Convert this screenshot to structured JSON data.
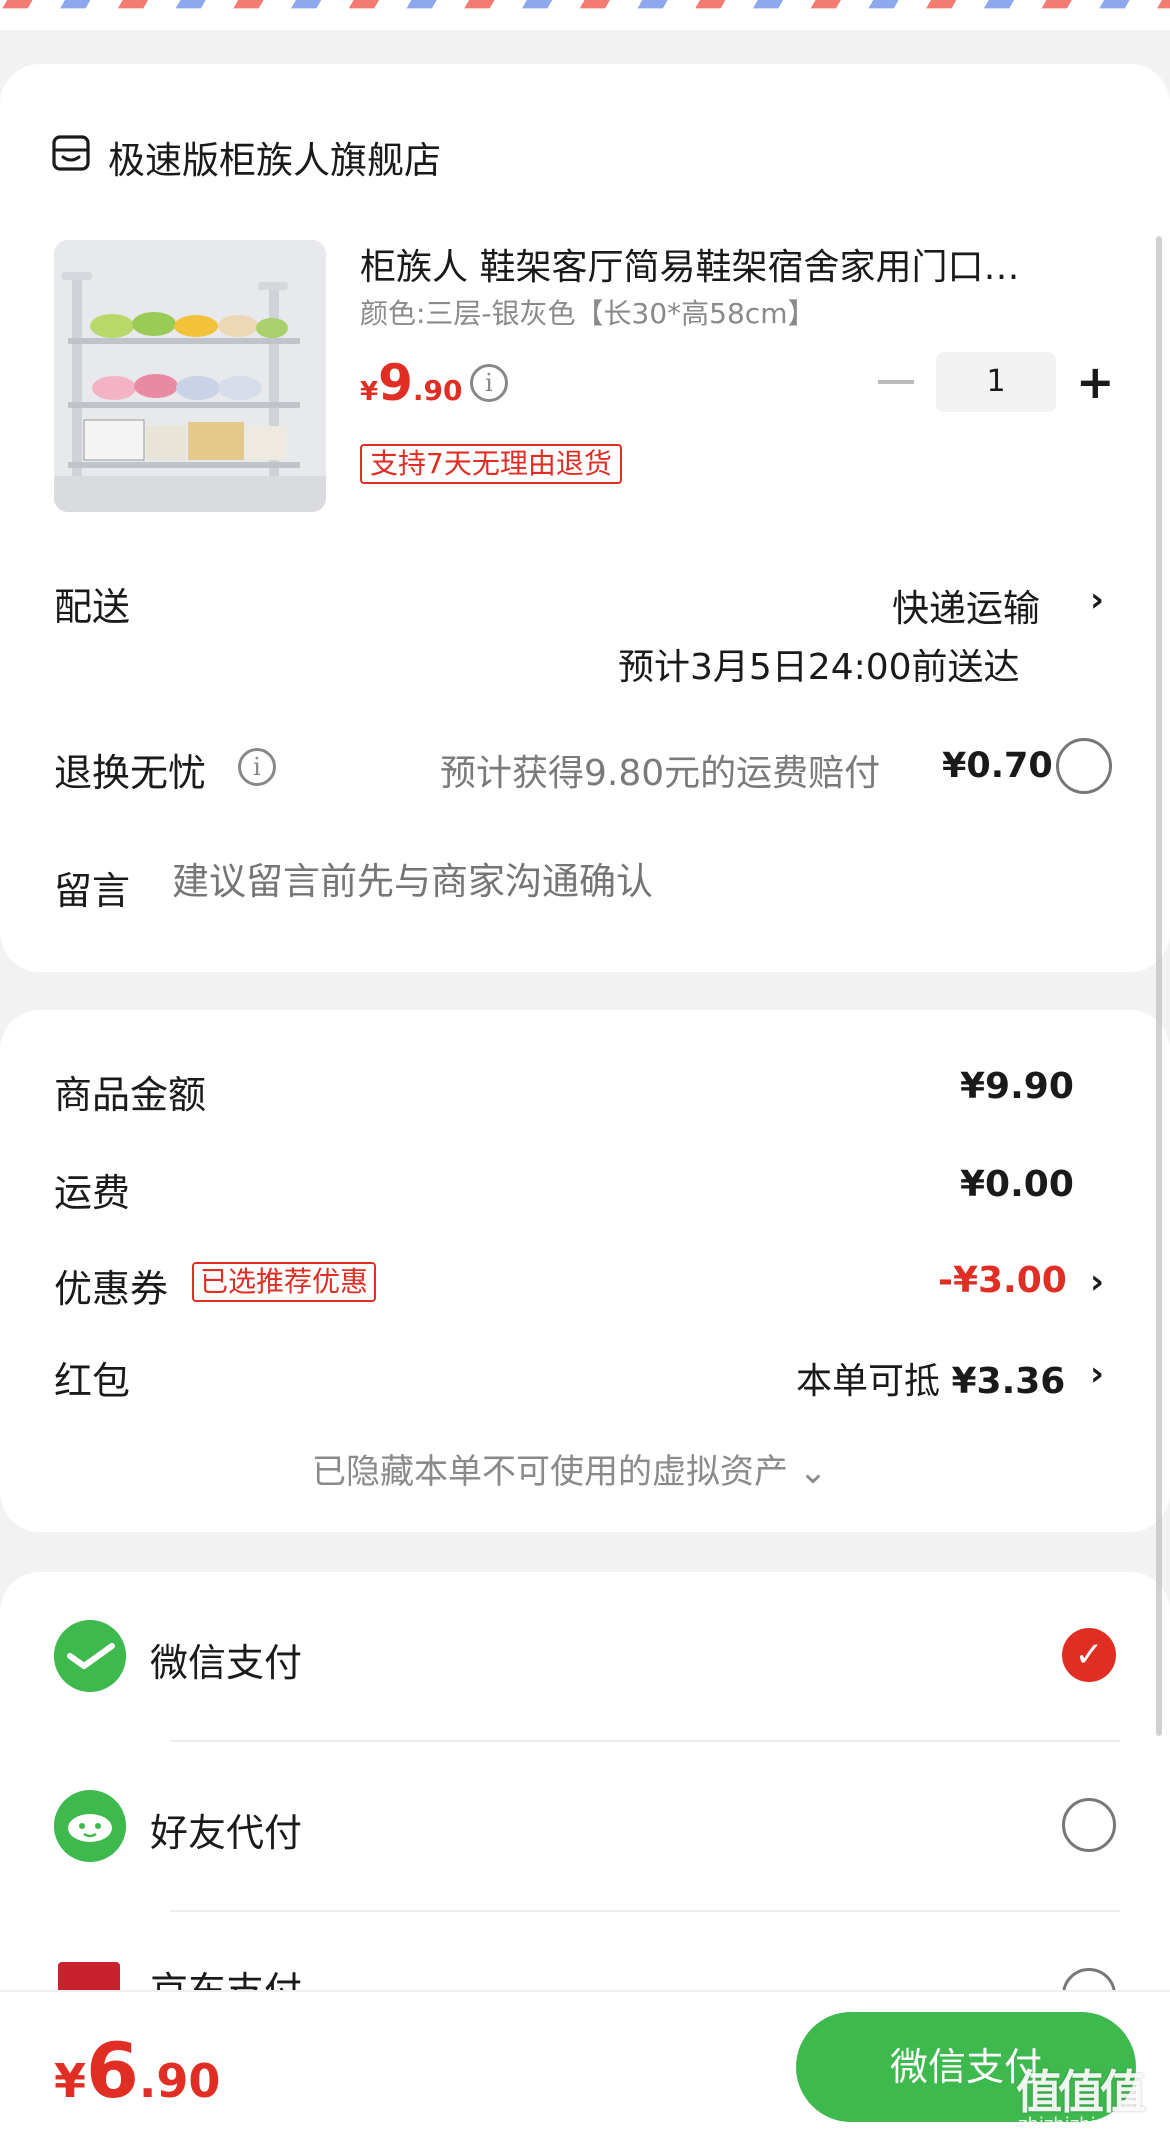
{
  "store": {
    "name": "极速版柜族人旗舰店",
    "icon": "store-icon"
  },
  "product": {
    "title": "柜族人 鞋架客厅简易鞋架宿舍家用门口…",
    "spec": "颜色:三层-银灰色【长30*高58cm】",
    "price_currency": "¥",
    "price_int": "9",
    "price_dec": ".90",
    "return_tag": "支持7天无理由退货",
    "quantity": "1",
    "minus_icon": "minus-icon",
    "plus_label": "+"
  },
  "delivery": {
    "label": "配送",
    "method": "快递运输",
    "eta": "预计3月5日24:00前送达",
    "chevron": "›"
  },
  "refund": {
    "label": "退换无忧",
    "info_glyph": "i",
    "desc": "预计获得9.80元的运费赔付",
    "price": "¥0.70"
  },
  "message": {
    "label": "留言",
    "placeholder": "建议留言前先与商家沟通确认"
  },
  "summary": {
    "goods_label": "商品金额",
    "goods_value": "¥9.90",
    "shipping_label": "运费",
    "shipping_value": "¥0.00",
    "coupon_label": "优惠券",
    "coupon_tag": "已选推荐优惠",
    "coupon_value": "-¥3.00",
    "redpack_label": "红包",
    "redpack_prefix": "本单可抵",
    "redpack_value": "¥3.36",
    "hidden_assets": "已隐藏本单不可使用的虚拟资产 ⌄",
    "chevron": "›"
  },
  "payment": {
    "options": [
      {
        "label": "微信支付",
        "selected": true,
        "icon": "wechat-pay-icon"
      },
      {
        "label": "好友代付",
        "selected": false,
        "icon": "friend-pay-icon"
      },
      {
        "label": "京东支付",
        "selected": false,
        "icon": "jd-pay-icon"
      }
    ],
    "check_glyph": "✓"
  },
  "footer": {
    "total_currency": "¥",
    "total_int": "6",
    "total_dec": ".90",
    "pay_button": "微信支付",
    "watermark": "值值值",
    "watermark_sub": "zhizhizhi.com"
  },
  "colors": {
    "accent_red": "#e02e24",
    "wechat_green": "#3eb94e",
    "airmail_red": "#f27b72",
    "airmail_blue": "#8ea8ee"
  }
}
